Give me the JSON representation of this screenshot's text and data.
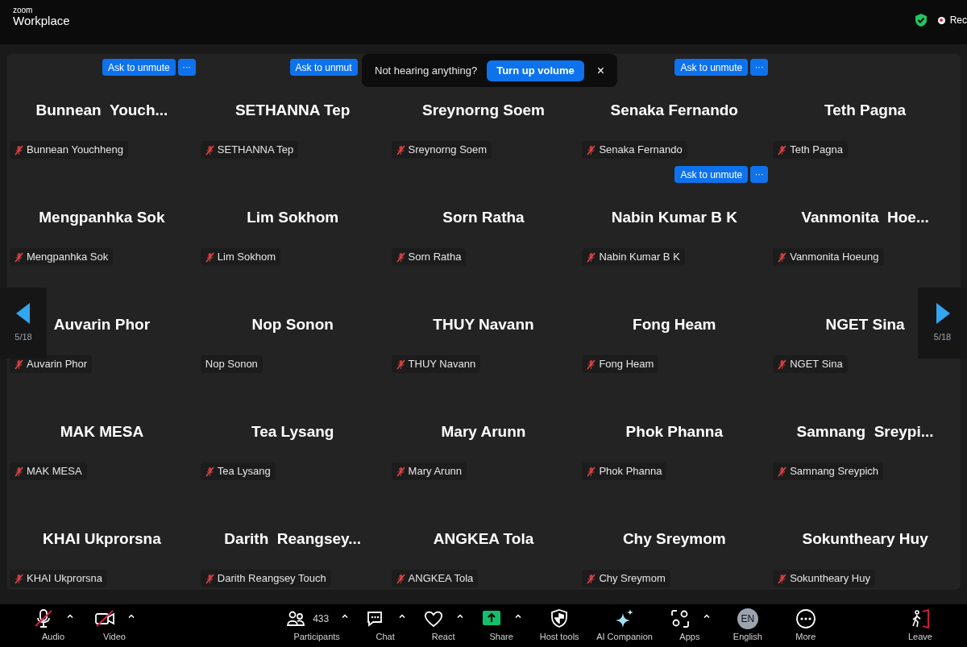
{
  "app": {
    "brand_small": "zoom",
    "brand": "Workplace",
    "recording": "Rec"
  },
  "toast": {
    "message": "Not hearing anything?",
    "action": "Turn up volume",
    "close": "×"
  },
  "pager": {
    "left": "5/18",
    "right": "5/18"
  },
  "tiles": [
    {
      "name": "Bunnean  Youch...",
      "label": "Bunnean Youchheng",
      "muted": true,
      "ask_button": "Ask to unmute",
      "more": "···"
    },
    {
      "name": "SETHANNA Tep",
      "label": "SETHANNA Tep",
      "muted": true,
      "ask_button": "Ask to unmut"
    },
    {
      "name": "Sreynorng Soem",
      "label": "Sreynorng Soem",
      "muted": true
    },
    {
      "name": "Senaka Fernando",
      "label": "Senaka Fernando",
      "muted": true,
      "ask_button": "Ask to unmute",
      "more": "···"
    },
    {
      "name": "Teth Pagna",
      "label": "Teth Pagna",
      "muted": true
    },
    {
      "name": "Mengpanhka Sok",
      "label": "Mengpanhka Sok",
      "muted": true
    },
    {
      "name": "Lim Sokhom",
      "label": "Lim Sokhom",
      "muted": true
    },
    {
      "name": "Sorn Ratha",
      "label": "Sorn Ratha",
      "muted": true
    },
    {
      "name": "Nabin Kumar B K",
      "label": "Nabin Kumar B K",
      "muted": true,
      "ask_button": "Ask to unmute",
      "more": "···"
    },
    {
      "name": "Vanmonita  Hoe...",
      "label": "Vanmonita Hoeung",
      "muted": true
    },
    {
      "name": "Auvarin Phor",
      "label": "Auvarin Phor",
      "muted": true
    },
    {
      "name": "Nop Sonon",
      "label": "Nop Sonon",
      "muted": false
    },
    {
      "name": "THUY Navann",
      "label": "THUY Navann",
      "muted": true
    },
    {
      "name": "Fong Heam",
      "label": "Fong Heam",
      "muted": true
    },
    {
      "name": "NGET Sina",
      "label": "NGET Sina",
      "muted": true
    },
    {
      "name": "MAK MESA",
      "label": "MAK MESA",
      "muted": true
    },
    {
      "name": "Tea Lysang",
      "label": "Tea Lysang",
      "muted": true
    },
    {
      "name": "Mary Arunn",
      "label": "Mary Arunn",
      "muted": true
    },
    {
      "name": "Phok Phanna",
      "label": "Phok Phanna",
      "muted": true
    },
    {
      "name": "Samnang  Sreypi...",
      "label": "Samnang Sreypich",
      "muted": true
    },
    {
      "name": "KHAI Ukprorsna",
      "label": "KHAI Ukprorsna",
      "muted": true
    },
    {
      "name": "Darith  Reangsey...",
      "label": "Darith Reangsey Touch",
      "muted": true
    },
    {
      "name": "ANGKEA Tola",
      "label": "ANGKEA Tola",
      "muted": true
    },
    {
      "name": "Chy Sreymom",
      "label": "Chy Sreymom",
      "muted": true
    },
    {
      "name": "Sokuntheary Huy",
      "label": "Sokuntheary Huy",
      "muted": true
    }
  ],
  "toolbar": [
    {
      "kind": "audio",
      "label": "Audio",
      "off": true,
      "has_menu": true
    },
    {
      "kind": "video",
      "label": "Video",
      "off": true,
      "has_menu": true
    },
    {
      "kind": "participants",
      "label": "Participants",
      "count": "433",
      "has_menu": true
    },
    {
      "kind": "chat",
      "label": "Chat",
      "has_menu": true
    },
    {
      "kind": "react",
      "label": "React",
      "has_menu": true
    },
    {
      "kind": "share",
      "label": "Share",
      "has_menu": true
    },
    {
      "kind": "host",
      "label": "Host tools",
      "has_menu": false
    },
    {
      "kind": "ai",
      "label": "AI Companion",
      "has_menu": false
    },
    {
      "kind": "apps",
      "label": "Apps",
      "has_menu": true
    },
    {
      "kind": "language",
      "label": "English",
      "badge": "EN",
      "has_menu": false
    },
    {
      "kind": "more",
      "label": "More",
      "has_menu": false
    },
    {
      "kind": "leave",
      "label": "Leave",
      "has_menu": false
    }
  ]
}
